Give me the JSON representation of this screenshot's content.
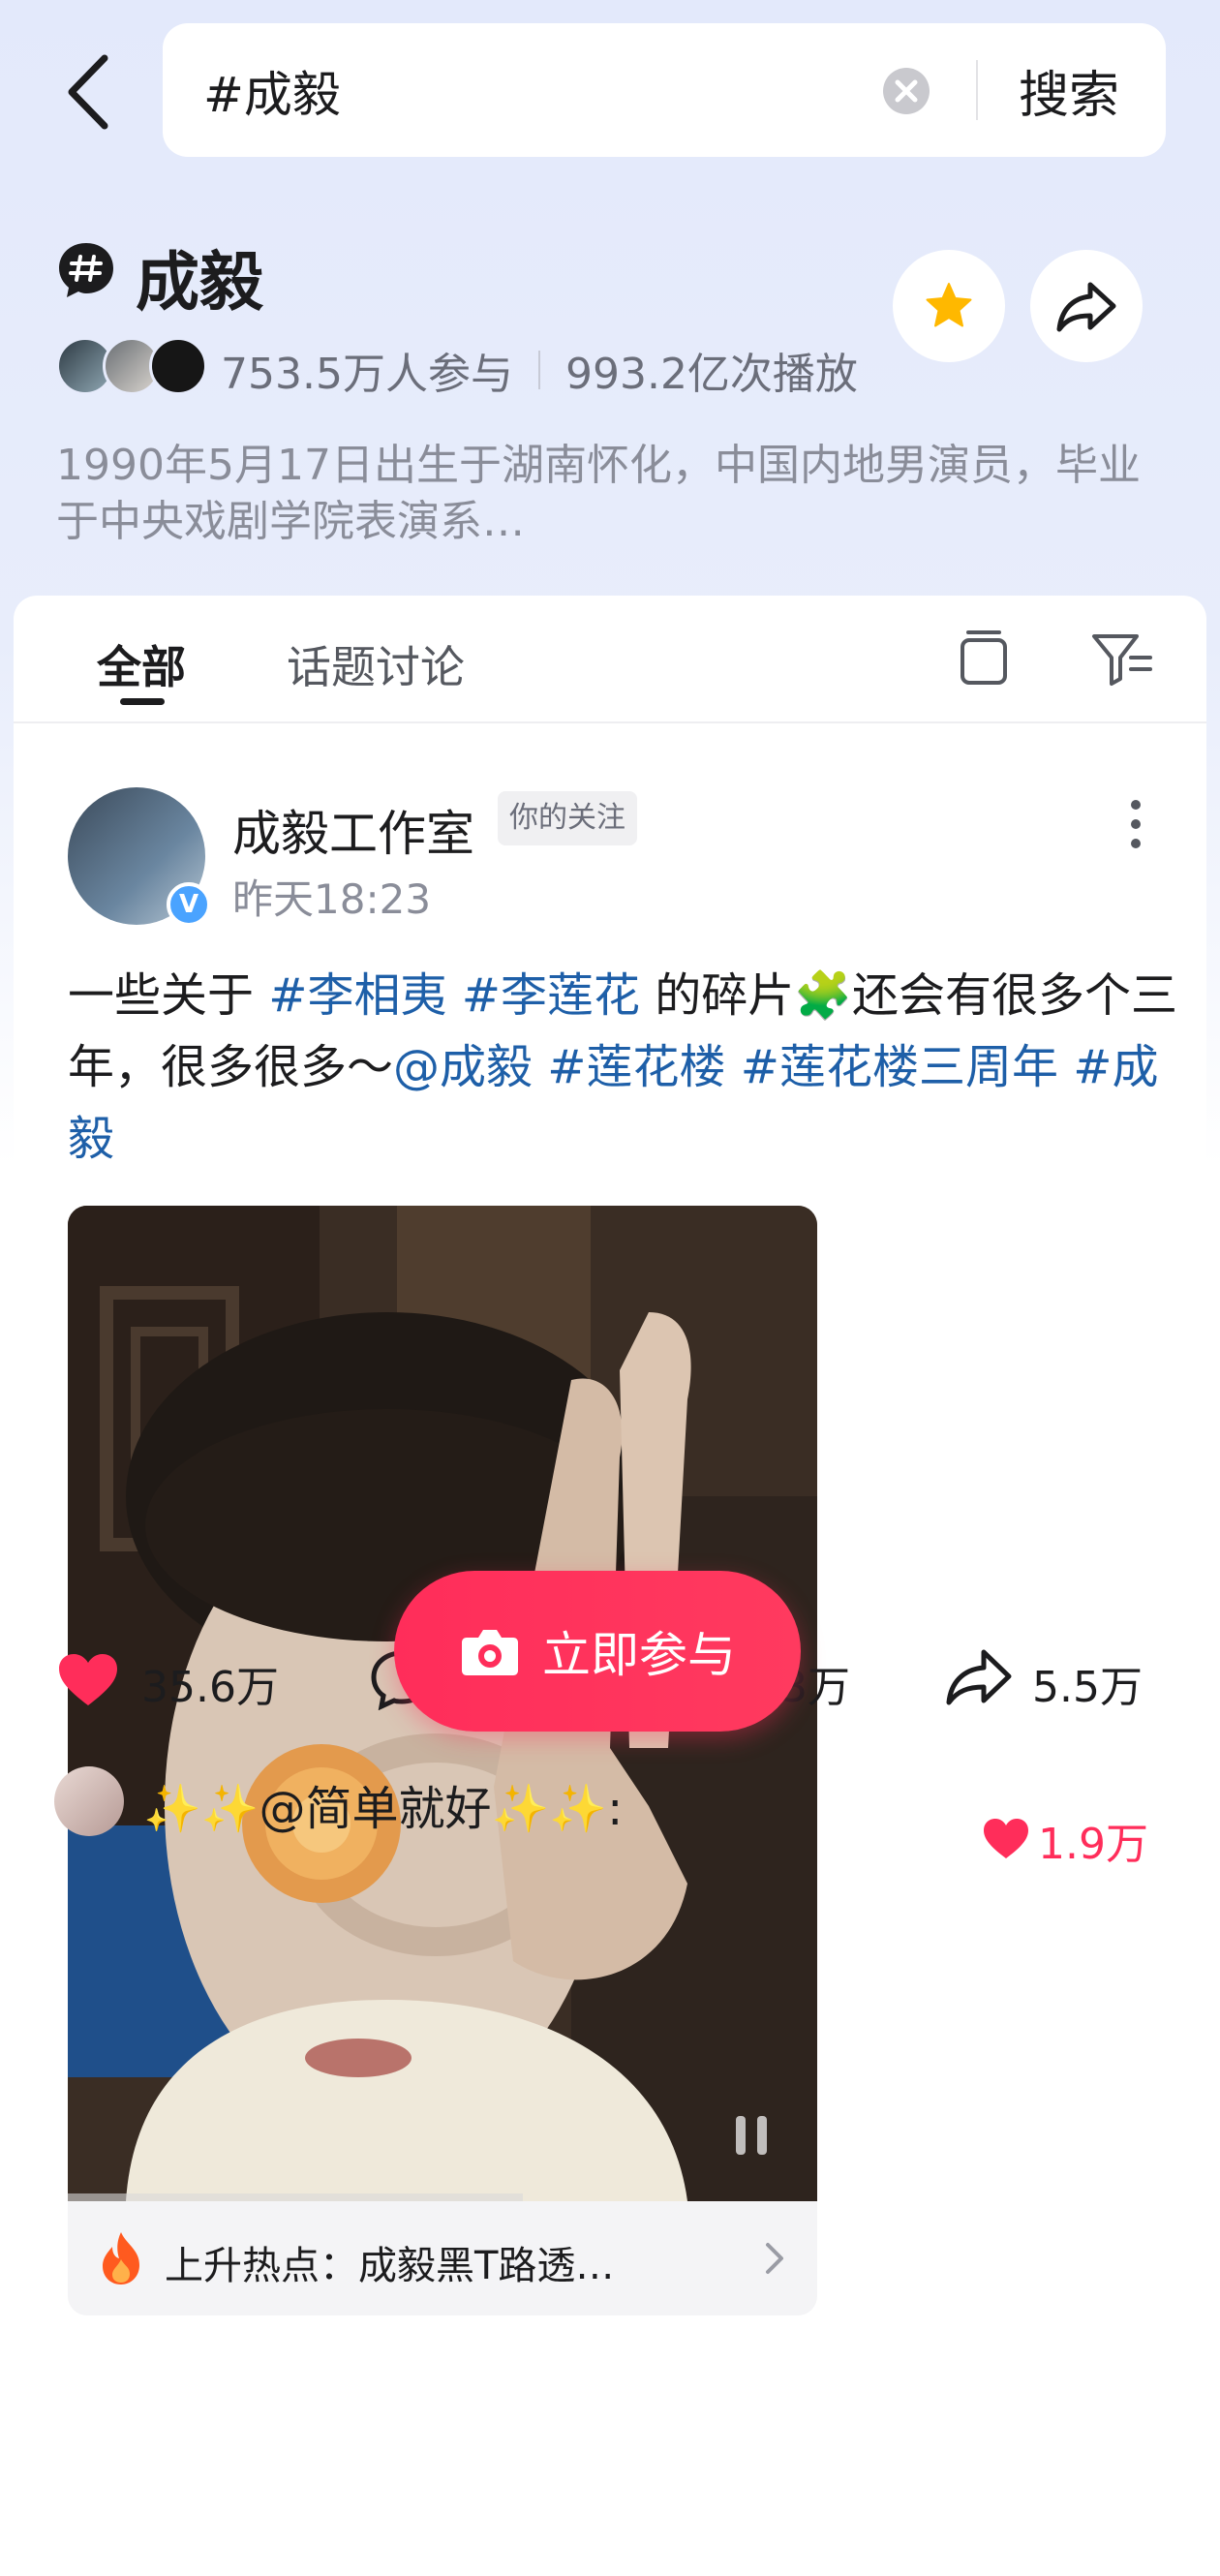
{
  "search": {
    "query": "#成毅",
    "button_label": "搜索"
  },
  "topic": {
    "title": "成毅",
    "participants": "753.5万人参与",
    "plays": "993.2亿次播放",
    "description": "1990年5月17日出生于湖南怀化，中国内地男演员，毕业于中央戏剧学院表演系…"
  },
  "tabs": {
    "all": "全部",
    "discussion": "话题讨论"
  },
  "post": {
    "author": "成毅工作室",
    "follow_tag": "你的关注",
    "time": "昨天18:23",
    "text_1": "一些关于 ",
    "tag_1": "#李相夷",
    "tag_2": "#李莲花",
    "text_2": " 的碎片🧩还会有很多个三年，很多很多～",
    "mention": "@成毅",
    "tag_3": "#莲花楼",
    "tag_4": "#莲花楼三周年",
    "tag_5": "#成毅",
    "hot_topic": "上升热点：成毅黑T路透…",
    "likes": "35.6万",
    "collects": "3万",
    "shares": "5.5万"
  },
  "join_button": "立即参与",
  "comment_preview": {
    "text": "✨✨@简单就好✨✨:",
    "likes": "1.9万"
  },
  "colors": {
    "accent": "#ff2d5a",
    "tag": "#1e5fa8",
    "star": "#ffb800"
  }
}
